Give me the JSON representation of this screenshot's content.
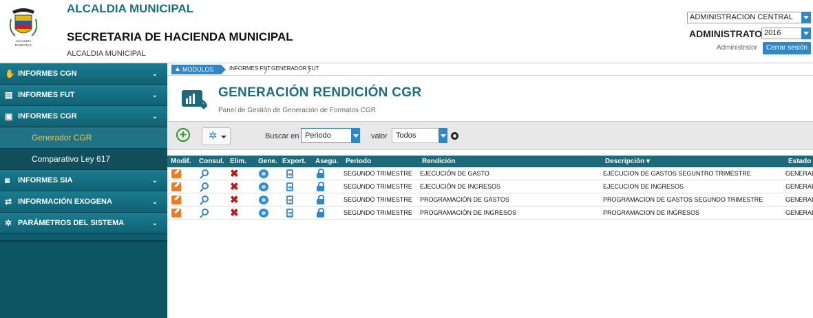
{
  "header": {
    "title": "ALCALDIA MUNICIPAL",
    "subtitle": "SECRETARIA DE HACIENDA MUNICIPAL",
    "small": "ALCALDIA MUNICIPAL",
    "logo_caption": "ALCALDIA MUNICIPAL",
    "entity_select": "ADMINISTRACION CENTRAL",
    "role": "ADMINISTRATOR",
    "year_select": "2016",
    "user": "Administrator",
    "logout_label": "Cerrar sesión"
  },
  "sidebar": {
    "items": [
      {
        "label": "INFORMES CGN",
        "icon": "handshake-icon"
      },
      {
        "label": "INFORMES FUT",
        "icon": "document-icon"
      },
      {
        "label": "INFORMES CGR",
        "icon": "report-icon"
      },
      {
        "label": "INFORMES SIA",
        "icon": "search-doc-icon"
      },
      {
        "label": "INFORMACIÓN EXOGENA",
        "icon": "exchange-icon"
      },
      {
        "label": "PARÁMETROS DEL SISTEMA",
        "icon": "gear-icon"
      }
    ],
    "subitems": [
      {
        "label": "Generador CGR",
        "active": true
      },
      {
        "label": "Comparativo Ley 617",
        "active": false
      }
    ]
  },
  "breadcrumb": [
    "MODULOS",
    "INFORMES FUT",
    "GENERADOR FUT"
  ],
  "page": {
    "title": "GENERACIÓN RENDICIÓN CGR",
    "subtitle": "Panel de Gestión de Generación de Formatos CGR"
  },
  "toolbar": {
    "search_label": "Buscar en",
    "search_field": "Periodo",
    "value_label": "valor",
    "value_field": "Todos"
  },
  "table": {
    "columns": [
      "Modif.",
      "Consul.",
      "Elim.",
      "Gene.",
      "Export.",
      "Asegu.",
      "Periodo",
      "Rendición",
      "Descripción",
      "Estado"
    ],
    "rows": [
      {
        "periodo": "SEGUNDO TRIMESTRE",
        "rendicion": "EJECUCIÓN DE GASTO",
        "descripcion": "EJECUCION DE GASTOS SEGUNTRO TRIMESTRE",
        "estado": "GENERADO"
      },
      {
        "periodo": "SEGUNDO TRIMESTRE",
        "rendicion": "EJECUCIÓN DE INGRESOS",
        "descripcion": "EJECUCION DE INGRESOS",
        "estado": "GENERADO"
      },
      {
        "periodo": "SEGUNDO TRIMESTRE",
        "rendicion": "PROGRAMACIÓN DE GASTOS",
        "descripcion": "PROGRAMACION DE GASTOS SEGUNDO TRIMESTRE",
        "estado": "GENERADO"
      },
      {
        "periodo": "SEGUNDO TRIMESTRE",
        "rendicion": "PROGRAMACIÓN DE INGRESOS",
        "descripcion": "PROGRAMACION DE INGRESOS",
        "estado": "GENERADO"
      }
    ]
  },
  "colors": {
    "accent": "#2f86c9",
    "sidebar": "#1b7c90",
    "header_table": "#1c6a7c",
    "active_text": "#f2c94c"
  }
}
